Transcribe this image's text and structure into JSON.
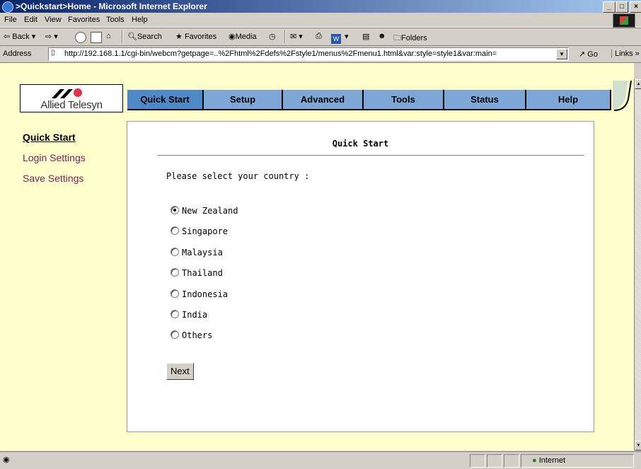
{
  "window": {
    "title": ">Quickstart>Home - Microsoft Internet Explorer",
    "controls": [
      "_",
      "□",
      "×"
    ]
  },
  "menu": [
    "File",
    "Edit",
    "View",
    "Favorites",
    "Tools",
    "Help"
  ],
  "toolbar": {
    "back": "Back",
    "search": "Search",
    "favorites": "Favorites",
    "media": "Media",
    "folders": "Folders"
  },
  "address": {
    "label": "Address",
    "url": "http://192.168.1.1/cgi-bin/webcm?getpage=..%2Fhtml%2Fdefs%2Fstyle1/menus%2Fmenu1.html&var:style=style1&var:main=",
    "go": "Go",
    "links": "Links"
  },
  "logo": {
    "brand": "Allied Telesyn"
  },
  "nav": {
    "tabs": [
      "Quick Start",
      "Setup",
      "Advanced",
      "Tools",
      "Status",
      "Help"
    ],
    "active": "Quick Start"
  },
  "sidebar": {
    "items": [
      "Quick Start",
      "Login Settings",
      "Save Settings"
    ]
  },
  "main": {
    "heading": "Quick Start",
    "prompt": "Please select your country :",
    "countries": [
      "New Zealand",
      "Singapore",
      "Malaysia",
      "Thailand",
      "Indonesia",
      "India",
      "Others"
    ],
    "selected": "New Zealand",
    "next_label": "Next"
  },
  "status": {
    "zone": "Internet"
  },
  "colors": {
    "page_background": "#ffffcc",
    "tab_blue": "#7ea7d8",
    "tab_active": "#4f88c8",
    "sidebar_link": "#7a1f5a"
  }
}
